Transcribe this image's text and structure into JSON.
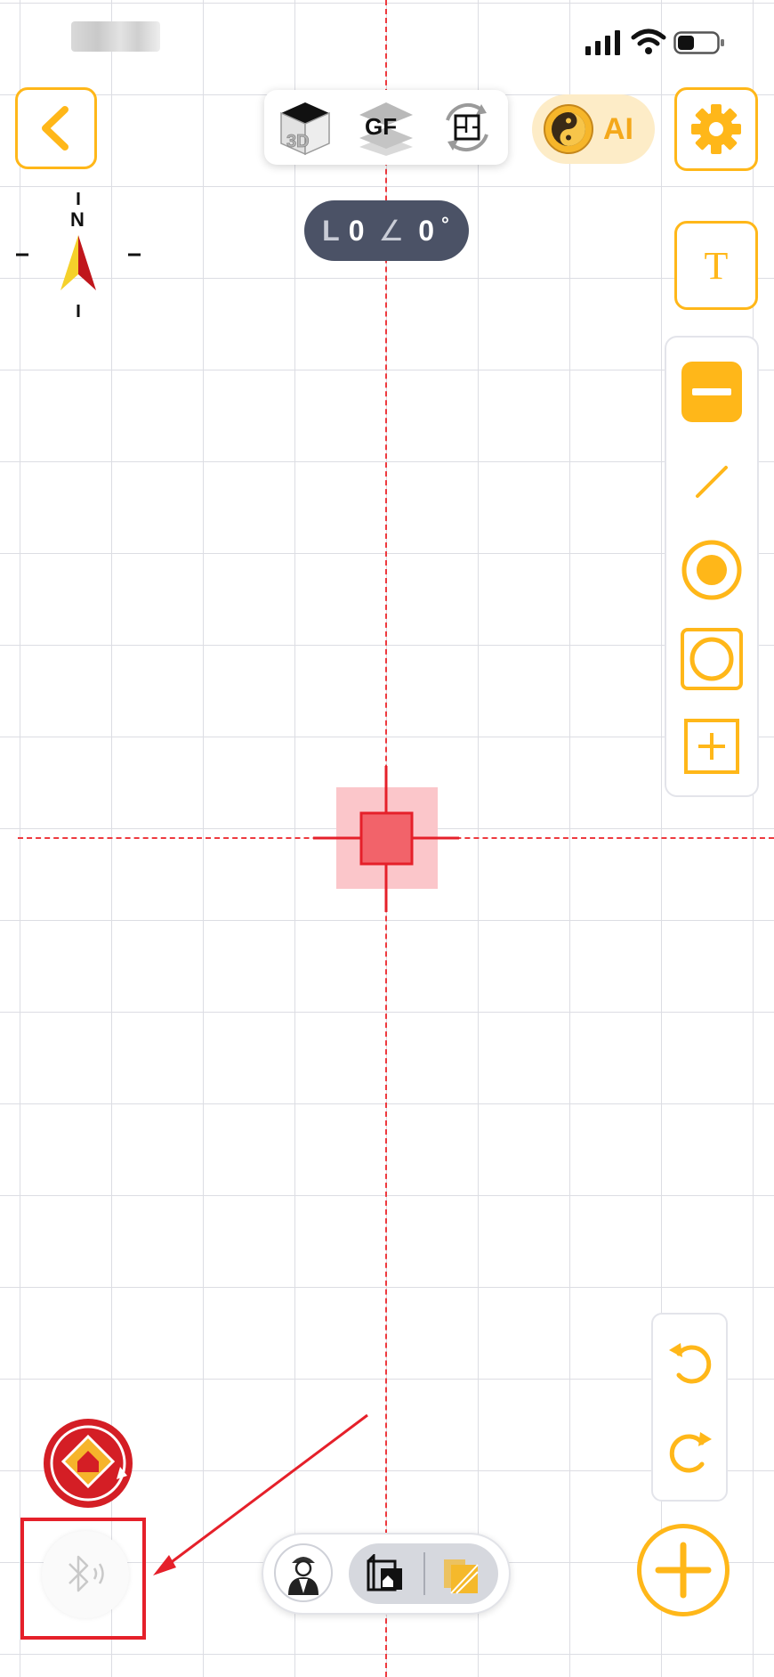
{
  "colors": {
    "accent": "#ffb719",
    "guide_red": "#ee3a3f",
    "pill_bg": "#4b5266",
    "annotation_red": "#e5202a"
  },
  "status_bar": {
    "time": "",
    "icons": [
      "signal-icon",
      "wifi-icon",
      "battery-icon"
    ]
  },
  "header": {
    "back_icon": "chevron-left-icon",
    "modes": [
      {
        "name": "3d-view",
        "label": "3D"
      },
      {
        "name": "gf-view",
        "label": "GF"
      },
      {
        "name": "floorplan-rotate",
        "label": ""
      }
    ],
    "ai_label": "AI",
    "settings_icon": "gear-icon"
  },
  "measure": {
    "length_prefix": "L",
    "length_value": "0",
    "angle_symbol": "∠",
    "angle_value": "0",
    "degree": "°"
  },
  "compass": {
    "north_label": "N"
  },
  "side_tools": {
    "text_tool_label": "T",
    "tools": [
      "minus-icon",
      "line-icon",
      "radio-circle-icon",
      "square-circle-icon",
      "square-plus-icon"
    ]
  },
  "history": {
    "undo_icon": "undo-icon",
    "redo_icon": "redo-icon"
  },
  "bottom_bar": {
    "items": [
      "worker-avatar-icon",
      "floorplan-doc-icon",
      "layers-icon"
    ]
  },
  "fab": {
    "icon": "plus-icon"
  },
  "bluetooth": {
    "icon": "bluetooth-icon",
    "status": "disconnected"
  }
}
